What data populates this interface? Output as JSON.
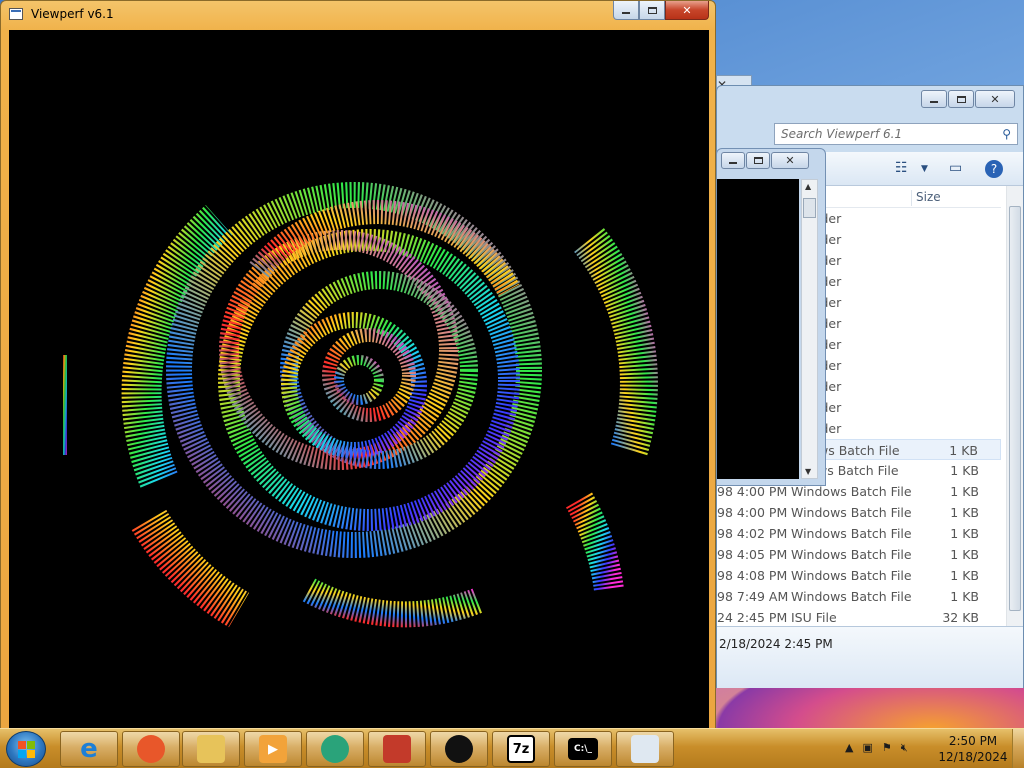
{
  "viewperf": {
    "title": "Viewperf v6.1"
  },
  "explorer": {
    "search_placeholder": "Search Viewperf 6.1",
    "size_header": "Size",
    "folder_rows": [
      "lder",
      "lder",
      "lder",
      "lder",
      "lder",
      "lder",
      "lder",
      "lder",
      "lder",
      "lder",
      "lder"
    ],
    "file_rows": [
      {
        "date": "",
        "type": "ws Batch File",
        "size": "1 KB"
      },
      {
        "date": "",
        "type": "ws Batch File",
        "size": "1 KB"
      },
      {
        "date": "98 4:00 PM",
        "type": "Windows Batch File",
        "size": "1 KB"
      },
      {
        "date": "98 4:00 PM",
        "type": "Windows Batch File",
        "size": "1 KB"
      },
      {
        "date": "98 4:02 PM",
        "type": "Windows Batch File",
        "size": "1 KB"
      },
      {
        "date": "98 4:05 PM",
        "type": "Windows Batch File",
        "size": "1 KB"
      },
      {
        "date": "98 4:08 PM",
        "type": "Windows Batch File",
        "size": "1 KB"
      },
      {
        "date": "98 7:49 AM",
        "type": "Windows Batch File",
        "size": "1 KB"
      },
      {
        "date": "24 2:45 PM",
        "type": "ISU File",
        "size": "32 KB"
      }
    ],
    "details": "2/18/2024 2:45 PM"
  },
  "taskbar": {
    "apps": [
      {
        "name": "internet-explorer",
        "glyph": "e",
        "color": "#1d7fd6"
      },
      {
        "name": "firefox",
        "glyph": "",
        "color": "#e8572a"
      },
      {
        "name": "file-explorer",
        "glyph": "",
        "color": "#e7c35a"
      },
      {
        "name": "media-player",
        "glyph": "▶",
        "color": "#f2a33a"
      },
      {
        "name": "media-center",
        "glyph": "",
        "color": "#2aa37a"
      },
      {
        "name": "toolbox",
        "glyph": "",
        "color": "#c33a2a"
      },
      {
        "name": "github",
        "glyph": "",
        "color": "#111111"
      },
      {
        "name": "7zip",
        "glyph": "7z",
        "color": "#000000"
      },
      {
        "name": "command-prompt",
        "glyph": "C:\\_",
        "color": "#000000"
      },
      {
        "name": "viewperf-window",
        "glyph": "",
        "color": "#dfe8f1"
      }
    ],
    "clock_time": "2:50 PM",
    "clock_date": "12/18/2024"
  },
  "colors": {
    "titlebar_active": "#f0b24a",
    "taskbar": "#c98e2a",
    "selection": "#eaf2fb"
  }
}
